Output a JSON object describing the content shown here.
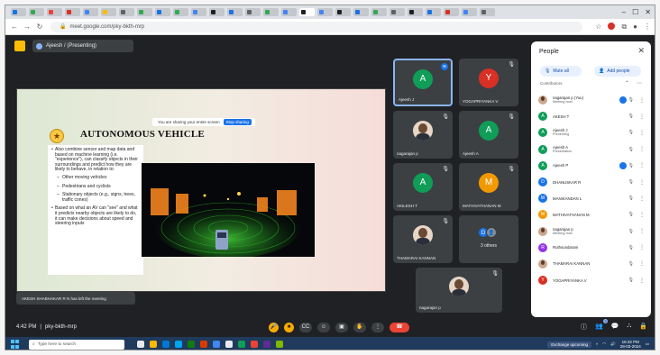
{
  "browser": {
    "tabs": [
      {
        "color": "#1a73e8"
      },
      {
        "color": "#34a853"
      },
      {
        "color": "#ea4335"
      },
      {
        "color": "#d93025"
      },
      {
        "color": "#4285f4"
      },
      {
        "color": "#fbbc04"
      },
      {
        "color": "#5f6368"
      },
      {
        "color": "#34a853"
      },
      {
        "color": "#1a73e8"
      },
      {
        "color": "#34a853"
      },
      {
        "color": "#4285f4"
      },
      {
        "color": "#202124"
      },
      {
        "color": "#1a73e8"
      },
      {
        "color": "#5f6368"
      },
      {
        "color": "#34a853"
      },
      {
        "color": "#4285f4"
      },
      {
        "color": "#202124",
        "active": true
      },
      {
        "color": "#4285f4"
      },
      {
        "color": "#202124"
      },
      {
        "color": "#1a73e8"
      },
      {
        "color": "#34a853"
      },
      {
        "color": "#5f6368"
      },
      {
        "color": "#202124"
      },
      {
        "color": "#1a73e8"
      },
      {
        "color": "#d93025"
      },
      {
        "color": "#4285f4"
      },
      {
        "color": "#5f6368"
      }
    ],
    "url": "meet.google.com/pky-bkth-mrp"
  },
  "meet": {
    "room_chip": "Ajeesh / (Presenting)",
    "share_bar": {
      "text": "You are sharing your entire screen",
      "stop_label": "Stop sharing"
    },
    "notice": "AKESH SHABHAKAR R N has left the meeting",
    "clock": "4:42 PM",
    "separator": "|",
    "meeting_code": "pky-bkth-mrp",
    "chat_badge": "3"
  },
  "slide": {
    "title": "AUTONOMOUS VEHICLE",
    "bullets": [
      {
        "text": "Also combine sensor and map data and based on machine learning (i.e. \"experience\"), can classify objects in their surroundings and predict how they are likely to behave, in relation to:",
        "type": "main"
      },
      {
        "text": "Other moving vehicles",
        "type": "sub"
      },
      {
        "text": "Pedestrians and cyclists",
        "type": "sub"
      },
      {
        "text": "Stationary objects (e.g., signs, trees, traffic cones)",
        "type": "sub"
      },
      {
        "text": "Based on what an AV can \"see\" and what it predicts nearby objects are likely to do, it can make decisions about speed and steering inputs",
        "type": "main"
      }
    ]
  },
  "tiles": [
    {
      "name": "Ajeesh J",
      "initial": "A",
      "color": "#0f9d58",
      "kind": "avatar",
      "speaking": true
    },
    {
      "name": "YOGAPRIYANKA V",
      "initial": "Y",
      "color": "#d93025",
      "kind": "avatar"
    },
    {
      "name": "nagarajan p",
      "kind": "photo"
    },
    {
      "name": "Ajeesh A",
      "initial": "A",
      "color": "#0f9d58",
      "kind": "avatar"
    },
    {
      "name": "AKILESH T",
      "initial": "A",
      "color": "#0f9d58",
      "kind": "avatar"
    },
    {
      "name": "MATHIVATHANAN M",
      "initial": "M",
      "color": "#f29900",
      "kind": "avatar"
    },
    {
      "name": "THAMARAI KANNAN",
      "kind": "photo"
    },
    {
      "label": "3 others",
      "kind": "others"
    },
    {
      "name": "nagarajan p",
      "kind": "photo"
    }
  ],
  "people": {
    "title": "People",
    "mute_all": "Mute all",
    "add_people": "Add people",
    "section": "Contributors",
    "list": [
      {
        "name": "nagarajan p (You)",
        "sub": "Meeting host",
        "kind": "photo",
        "indicator": true
      },
      {
        "name": "AKESH T",
        "initial": "A",
        "color": "#0f9d58"
      },
      {
        "name": "Ajeesh J",
        "sub": "Presenting",
        "initial": "A",
        "color": "#0f9d58"
      },
      {
        "name": "Ajeesh A",
        "sub": "Presentation",
        "initial": "A",
        "color": "#0f9d58"
      },
      {
        "name": "Ajeesh P",
        "initial": "A",
        "color": "#0f9d58",
        "indicator": true
      },
      {
        "name": "DHANUSKAR R",
        "initial": "D",
        "color": "#1a73e8"
      },
      {
        "name": "MANIKANDAN L",
        "initial": "M",
        "color": "#1a73e8"
      },
      {
        "name": "MATHIVATHANAN M",
        "initial": "M",
        "color": "#f29900"
      },
      {
        "name": "nagarajan p",
        "sub": "Meeting host",
        "kind": "photo"
      },
      {
        "name": "Ruthsundaram",
        "initial": "R",
        "color": "#9334e6"
      },
      {
        "name": "THAMARAI KANNAN",
        "kind": "photo"
      },
      {
        "name": "YOGAPRIYANKA V",
        "initial": "Y",
        "color": "#d93025"
      }
    ]
  },
  "taskbar": {
    "search_placeholder": "Type here to search",
    "status": "Exchange upcoming",
    "time": "16:42 PM",
    "date": "28-03-2024",
    "apps": [
      {
        "color": "#e8eaed"
      },
      {
        "color": "#ffb900"
      },
      {
        "color": "#0078d4"
      },
      {
        "color": "#00a4ef"
      },
      {
        "color": "#107c10"
      },
      {
        "color": "#d83b01"
      },
      {
        "color": "#4285f4"
      },
      {
        "color": "#e8eaed"
      },
      {
        "color": "#0f9d58"
      },
      {
        "color": "#ea4335"
      },
      {
        "color": "#5c2d91"
      },
      {
        "color": "#7fba00"
      }
    ]
  }
}
